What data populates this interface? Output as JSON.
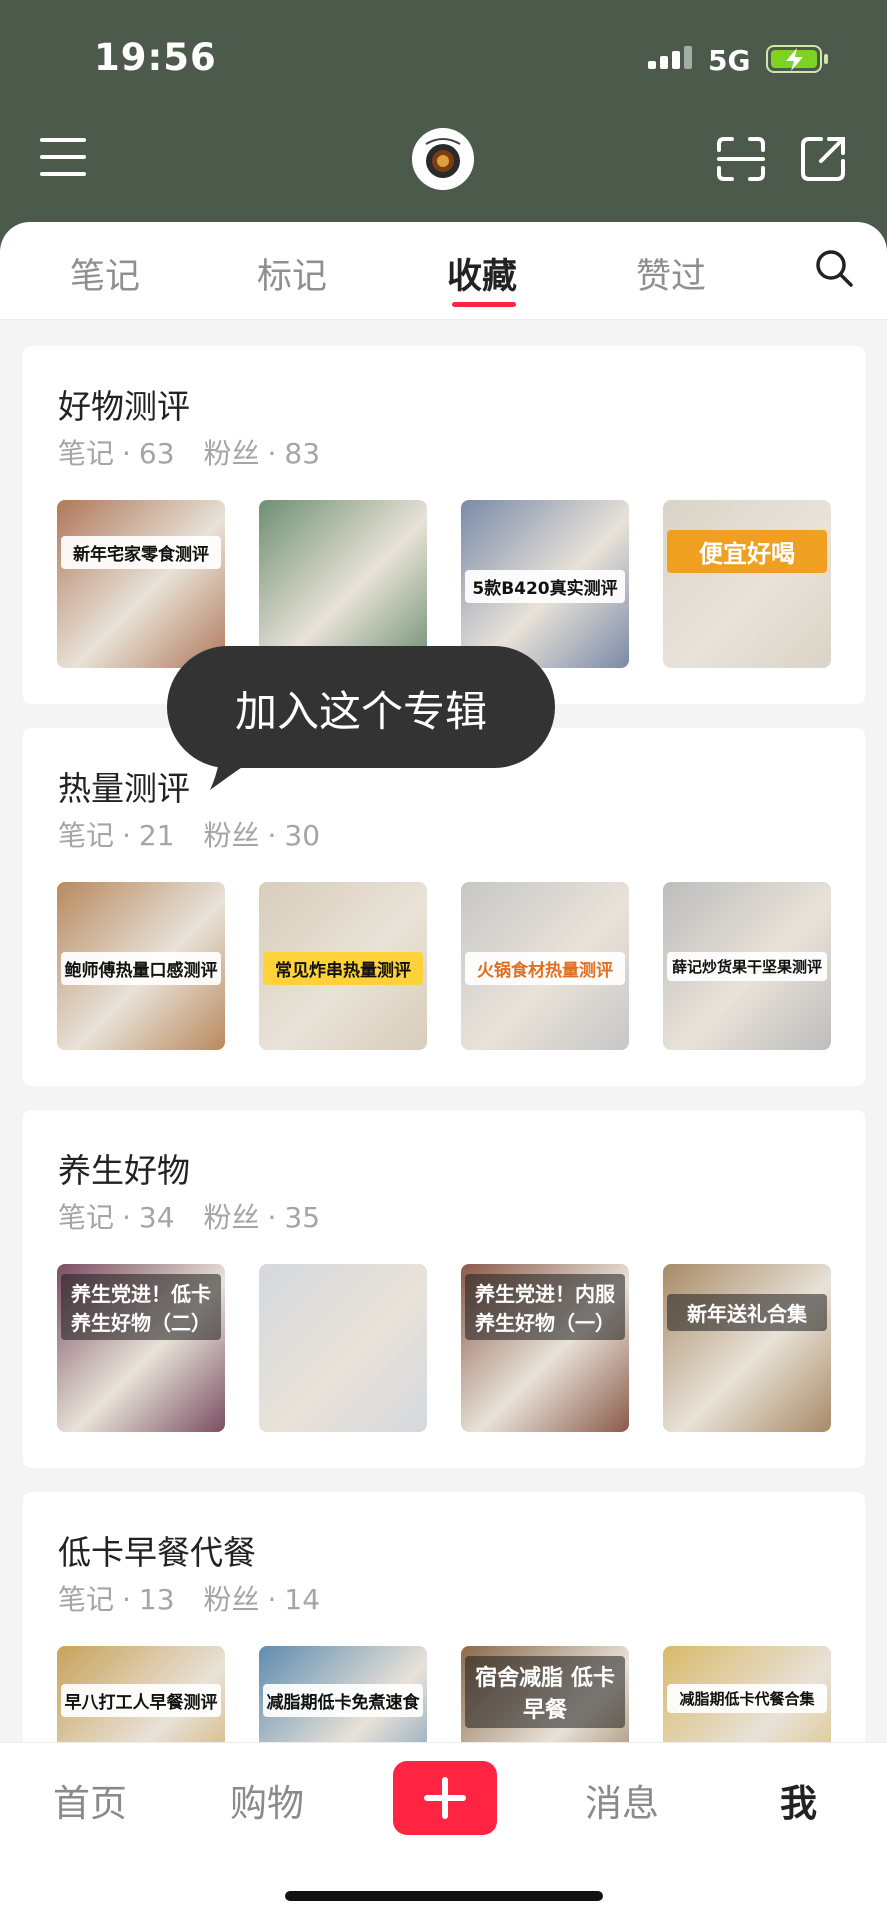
{
  "status_bar": {
    "time": "19:56",
    "network": "5G"
  },
  "header": {
    "icons": [
      "menu-icon",
      "avatar",
      "scan-icon",
      "share-icon"
    ]
  },
  "tabs": [
    {
      "label": "笔记",
      "active": false
    },
    {
      "label": "标记",
      "active": false
    },
    {
      "label": "收藏",
      "active": true
    },
    {
      "label": "赞过",
      "active": false
    }
  ],
  "tooltip": "加入这个专辑",
  "albums": [
    {
      "title": "好物测评",
      "notes_label": "笔记",
      "notes": "63",
      "fans_label": "粉丝",
      "fans": "83",
      "thumbs": [
        "新年宅家零食测评",
        "",
        "5款B420真实测评",
        "便宜好喝"
      ],
      "thumb_colors": [
        "#b0785a",
        "#6e8f72",
        "#7a8aa8",
        "#d9d3c8"
      ]
    },
    {
      "title": "热量测评",
      "notes_label": "笔记",
      "notes": "21",
      "fans_label": "粉丝",
      "fans": "30",
      "thumbs": [
        "鲍师傅热量口感测评",
        "常见炸串热量测评",
        "火锅食材热量测评",
        "薛记炒货果干坚果测评"
      ],
      "thumb_colors": [
        "#b9895e",
        "#d9cdbb",
        "#c7c7c7",
        "#bdbdbd"
      ]
    },
    {
      "title": "养生好物",
      "notes_label": "笔记",
      "notes": "34",
      "fans_label": "粉丝",
      "fans": "35",
      "thumbs": [
        "养生党进！低卡养生好物（二）",
        "",
        "养生党进！内服养生好物（一）",
        "新年送礼合集"
      ],
      "thumb_colors": [
        "#7a4e62",
        "#d5d8de",
        "#8a5a4a",
        "#a88a66"
      ]
    },
    {
      "title": "低卡早餐代餐",
      "notes_label": "笔记",
      "notes": "13",
      "fans_label": "粉丝",
      "fans": "14",
      "thumbs": [
        "早八打工人早餐测评",
        "减脂期低卡免煮速食",
        "宿舍减脂 低卡早餐",
        "减脂期低卡代餐合集"
      ],
      "thumb_colors": [
        "#c9a25a",
        "#5f8cb0",
        "#8a6a4a",
        "#d9b96a"
      ]
    }
  ],
  "bottom_nav": {
    "home": "首页",
    "shop": "购物",
    "messages": "消息",
    "me": "我"
  }
}
